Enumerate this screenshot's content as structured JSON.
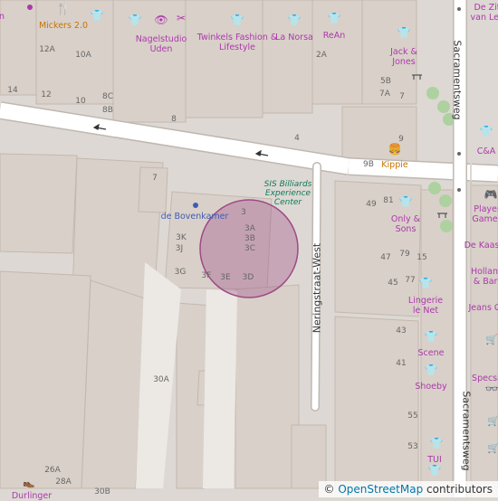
{
  "colors": {
    "background": "#ddd8d3",
    "building": "#d9d0c9",
    "road": "#ffffff",
    "road_casing": "#bfb8b0",
    "shop": "#ac39ac",
    "food": "#c77400",
    "leisure_text": "#0f7a5c",
    "marker_fill": "rgba(157,74,133,0.35)",
    "marker_stroke": "#9d4a85"
  },
  "streets": {
    "neringstraat": "Neringstraat-West",
    "sacrament_top": "Sacramentsweg",
    "sacrament_bottom": "Sacramentsweg"
  },
  "pois": {
    "micker": {
      "name": "Mickers 2.0",
      "icon": "fork-knife-icon"
    },
    "nagelstudio": {
      "name": "Nagelstudio Uden",
      "icon": "beauty-icon"
    },
    "twinkels": {
      "name": "Twinkels Fashion & Lifestyle",
      "icon": "clothes-icon"
    },
    "lanorsa": {
      "name": "La Norsa",
      "icon": "clothes-icon"
    },
    "rean": {
      "name": "ReAn",
      "icon": "clothes-icon"
    },
    "jackjones": {
      "name": "Jack & Jones",
      "icon": "clothes-icon"
    },
    "dezit": {
      "name": "De Zit van Lex",
      "icon": ""
    },
    "kippie": {
      "name": "Kippie",
      "icon": "burger-icon"
    },
    "ca": {
      "name": "C&A",
      "icon": "clothes-icon"
    },
    "sis": {
      "name": "SIS Billiards Experience Center"
    },
    "bovenkamer": {
      "name": "de Bovenkamer"
    },
    "onlysons": {
      "name": "Only & Sons",
      "icon": "clothes-icon"
    },
    "playergames": {
      "name": "Player Games",
      "icon": "gamepad-icon"
    },
    "dekaas": {
      "name": "De Kaas",
      "icon": ""
    },
    "hollandbarr": {
      "name": "Holland & Barr",
      "icon": "shop-icon"
    },
    "jeansc": {
      "name": "Jeans C",
      "icon": ""
    },
    "lingerie": {
      "name": "Lingerie le Net",
      "icon": "clothes-icon"
    },
    "scene": {
      "name": "Scene",
      "icon": "clothes-icon"
    },
    "shoeby": {
      "name": "Shoeby",
      "icon": "clothes-icon"
    },
    "specsa": {
      "name": "Specsa",
      "icon": "optician-icon"
    },
    "tui": {
      "name": "TUI",
      "icon": "clothes-icon"
    },
    "durlinger": {
      "name": "Durlinger",
      "icon": "shoe-icon"
    },
    "top_n": {
      "name": "n",
      "icon": ""
    }
  },
  "housenumbers": [
    "12A",
    "10A",
    "14",
    "12",
    "10",
    "8C",
    "8B",
    "8",
    "4",
    "2A",
    "5B",
    "7A",
    "7",
    "9",
    "9B",
    "7",
    "3",
    "3A",
    "3B",
    "3C",
    "3K",
    "3J",
    "3G",
    "3F",
    "3E",
    "3D",
    "30A",
    "26A",
    "28A",
    "30B",
    "49",
    "81",
    "47",
    "79",
    "15",
    "45",
    "77",
    "43",
    "41",
    "55",
    "53"
  ],
  "attribution": {
    "prefix": "© ",
    "link": "OpenStreetMap",
    "suffix": " contributors"
  }
}
